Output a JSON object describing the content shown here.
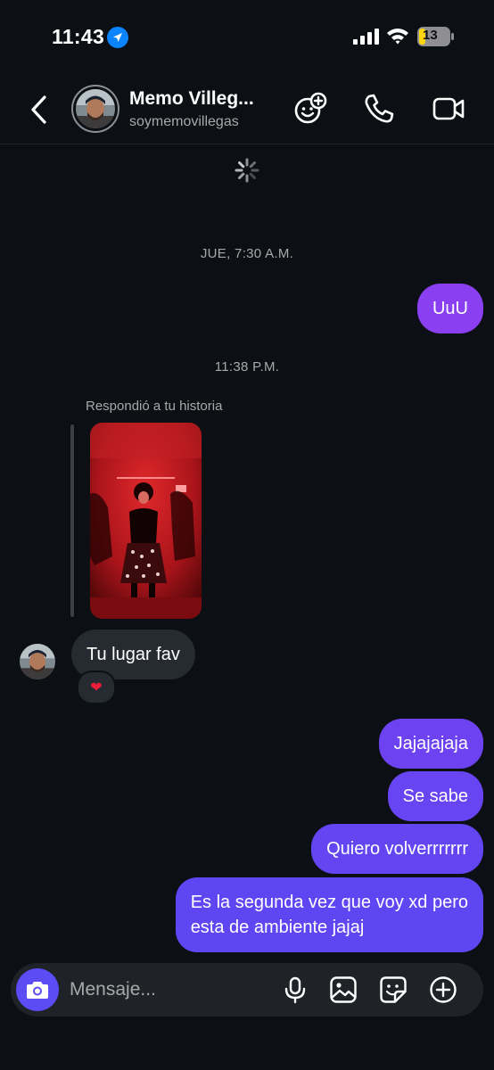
{
  "status_bar": {
    "time": "11:43",
    "battery": "13"
  },
  "header": {
    "name": "Memo Villeg...",
    "username": "soymemovillegas"
  },
  "messages": {
    "ts1": "JUE, 7:30 A.M.",
    "out1": "UuU",
    "ts2": "11:38 P.M.",
    "reply_note": "Respondió a tu historia",
    "in1": "Tu lugar fav",
    "reaction": "❤",
    "out2": "Jajajajaja",
    "out3": "Se sabe",
    "out4": "Quiero volverrrrrrr",
    "out5_line1": "Es la segunda vez que voy xd pero",
    "out5_line2": "esta de ambiente jajaj"
  },
  "composer": {
    "placeholder": "Mensaje..."
  },
  "colors": {
    "background": "#0c1014",
    "bubble_in": "#262b31",
    "bubble_out_top": "#8a3ff0",
    "bubble_out_bottom": "#5f46f2",
    "camera_button": "#5b4cf5",
    "location_icon": "#0a84ff",
    "heart": "#ed1c3b"
  },
  "icons": [
    "location-arrow-icon",
    "signal-icon",
    "wifi-icon",
    "battery-icon",
    "back-icon",
    "add-effect-icon",
    "phone-icon",
    "video-icon",
    "spinner-icon",
    "camera-icon",
    "microphone-icon",
    "gallery-icon",
    "sticker-icon",
    "plus-circle-icon"
  ]
}
